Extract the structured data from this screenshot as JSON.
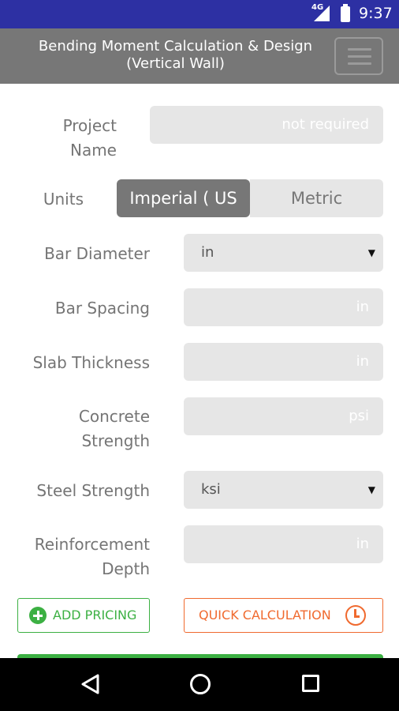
{
  "status_bar": {
    "network": "4G",
    "time": "9:37"
  },
  "app_bar": {
    "title_line1": "Bending Moment Calculation & Design",
    "title_line2": "(Vertical Wall)",
    "menu_icon": "hamburger-menu-icon"
  },
  "form": {
    "project_name": {
      "label_line1": "Project",
      "label_line2": "Name",
      "placeholder": "not required",
      "value": ""
    },
    "units": {
      "label": "Units",
      "options": [
        "Imperial ( US",
        "Metric"
      ],
      "selected": "Imperial ( US"
    },
    "bar_diameter": {
      "label": "Bar Diameter",
      "value": "in"
    },
    "bar_spacing": {
      "label": "Bar Spacing",
      "placeholder": "in",
      "value": ""
    },
    "slab_thickness": {
      "label": "Slab Thickness",
      "placeholder": "in",
      "value": ""
    },
    "concrete_strength": {
      "label_line1": "Concrete",
      "label_line2": "Strength",
      "placeholder": "psi",
      "value": ""
    },
    "steel_strength": {
      "label": "Steel Strength",
      "value": "ksi"
    },
    "reinforcement_depth": {
      "label_line1": "Reinforcement",
      "label_line2": "Depth",
      "placeholder": "in",
      "value": ""
    }
  },
  "buttons": {
    "add_pricing": "ADD PRICING",
    "quick_calculation": "QUICK CALCULATION"
  },
  "colors": {
    "status_bar": "#2d30a3",
    "app_bar": "#777777",
    "field_bg": "#e6e6e6",
    "green": "#3cb043",
    "orange": "#f06a2f"
  },
  "nav_icons": [
    "back-icon",
    "home-icon",
    "recents-icon"
  ]
}
